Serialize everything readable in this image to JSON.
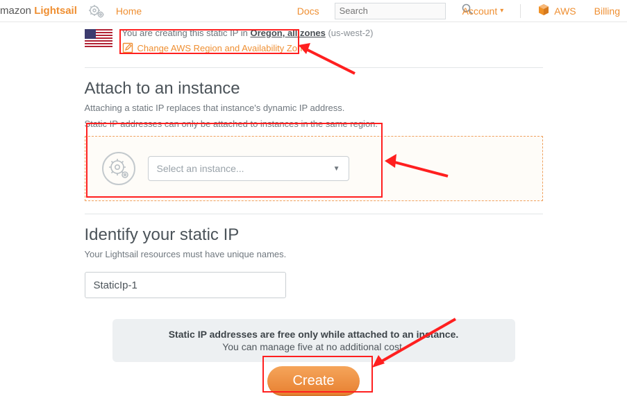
{
  "nav": {
    "brand_prefix": "mazon ",
    "brand_suffix": "Lightsail",
    "home": "Home",
    "docs": "Docs",
    "search_placeholder": "Search",
    "account": "Account",
    "aws": "AWS",
    "billing": "Billing"
  },
  "region": {
    "prefix": "You are creating this static IP in ",
    "location": "Oregon, all zones",
    "code": " (us-west-2)",
    "change_label": "Change AWS Region and Availability Zone"
  },
  "attach": {
    "title": "Attach to an instance",
    "sub": "Attaching a static IP replaces that instance's dynamic IP address.",
    "note": "Static IP addresses can only be attached to instances in the same region.",
    "select_placeholder": "Select an instance..."
  },
  "identify": {
    "title": "Identify your static IP",
    "sub": "Your Lightsail resources must have unique names.",
    "value": "StaticIp-1"
  },
  "info": {
    "strong": "Static IP addresses are free only while attached to an instance.",
    "line2": "You can manage five at no additional cost."
  },
  "create_label": "Create"
}
